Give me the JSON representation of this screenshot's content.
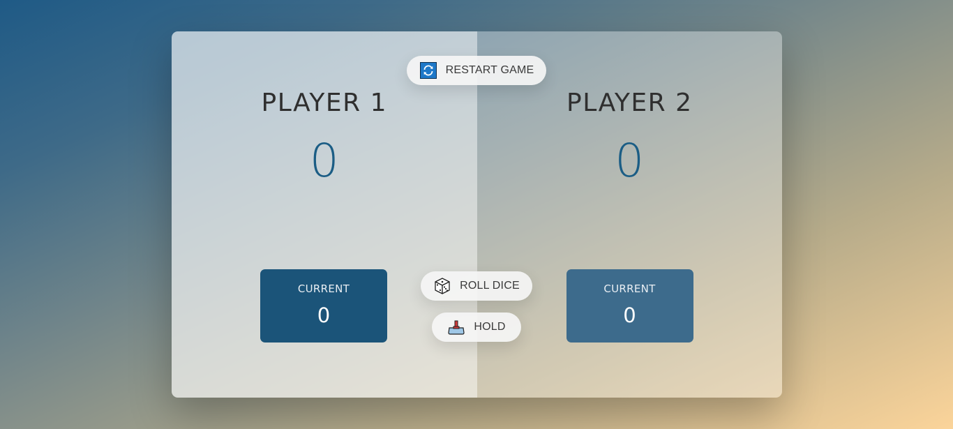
{
  "players": [
    {
      "name": "PLAYER 1",
      "score": "0",
      "current_label": "CURRENT",
      "current_score": "0"
    },
    {
      "name": "PLAYER 2",
      "score": "0",
      "current_label": "CURRENT",
      "current_score": "0"
    }
  ],
  "buttons": {
    "restart": {
      "label": "RESTART GAME",
      "icon": "restart-icon"
    },
    "roll": {
      "label": "ROLL DICE",
      "icon": "dice-icon"
    },
    "hold": {
      "label": "HOLD",
      "icon": "hold-icon"
    }
  },
  "colors": {
    "accent": "#1b5d85",
    "current_active": "#1b5479",
    "current_inactive": "#3d6b8c"
  }
}
